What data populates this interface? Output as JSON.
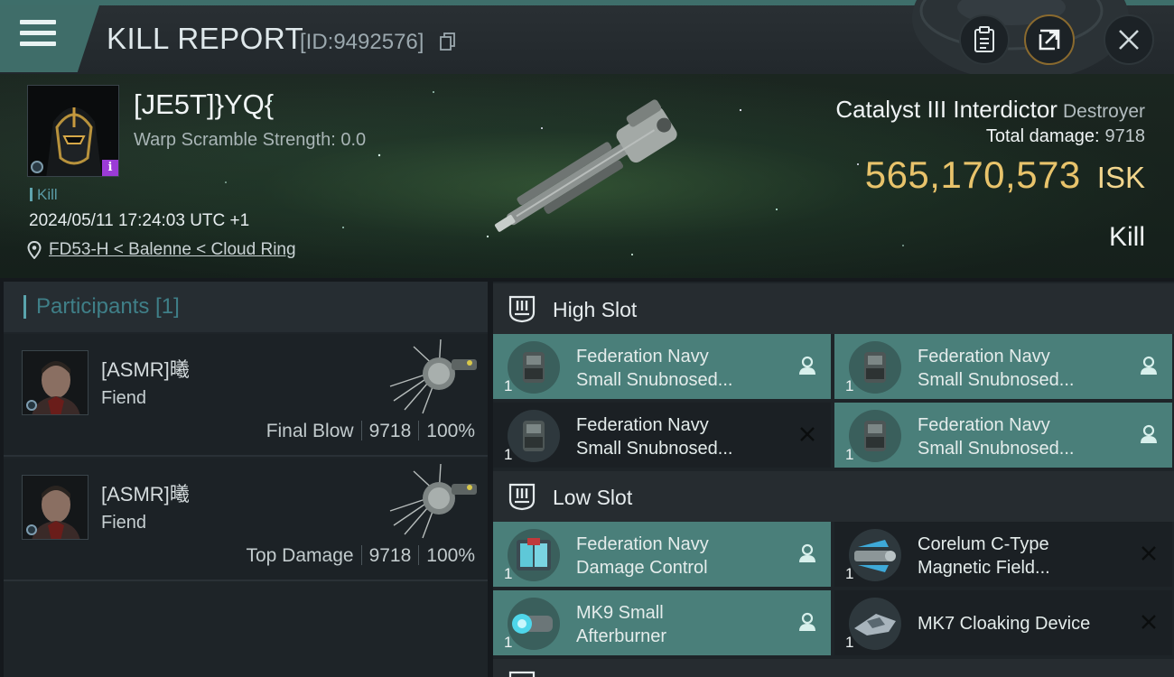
{
  "header": {
    "title": "KILL REPORT",
    "report_id": "[ID:9492576]"
  },
  "victim": {
    "name": "[JE5T]}YQ{",
    "warp_scramble": "Warp Scramble Strength: 0.0",
    "kill_tag": "Kill",
    "timestamp": "2024/05/11 17:24:03 UTC +1",
    "location": "FD53-H < Balenne < Cloud Ring"
  },
  "ship": {
    "name": "Catalyst III Interdictor",
    "class": "Destroyer",
    "total_damage_label": "Total damage:",
    "total_damage": "9718",
    "isk_value": "565,170,573",
    "isk_unit": "ISK",
    "result": "Kill"
  },
  "participants": {
    "title": "Participants [1]",
    "items": [
      {
        "name": "[ASMR]曦",
        "ship": "Fiend",
        "role": "Final Blow",
        "damage": "9718",
        "percent": "100%"
      },
      {
        "name": "[ASMR]曦",
        "ship": "Fiend",
        "role": "Top Damage",
        "damage": "9718",
        "percent": "100%"
      }
    ]
  },
  "slots": {
    "high_title": "High Slot",
    "low_title": "Low Slot",
    "high": [
      {
        "name": "Federation Navy Small Snubnosed...",
        "line1": "Federation Navy",
        "line2": "Small Snubnosed...",
        "qty": "1",
        "status": "dropped"
      },
      {
        "name": "Federation Navy Small Snubnosed...",
        "line1": "Federation Navy",
        "line2": "Small Snubnosed...",
        "qty": "1",
        "status": "dropped"
      },
      {
        "name": "Federation Navy Small Snubnosed...",
        "line1": "Federation Navy",
        "line2": "Small Snubnosed...",
        "qty": "1",
        "status": "destroyed"
      },
      {
        "name": "Federation Navy Small Snubnosed...",
        "line1": "Federation Navy",
        "line2": "Small Snubnosed...",
        "qty": "1",
        "status": "dropped"
      }
    ],
    "low": [
      {
        "line1": "Federation Navy",
        "line2": "Damage Control",
        "qty": "1",
        "status": "dropped"
      },
      {
        "line1": "Corelum C-Type",
        "line2": "Magnetic Field...",
        "qty": "1",
        "status": "destroyed"
      },
      {
        "line1": "MK9 Small",
        "line2": "Afterburner",
        "qty": "1",
        "status": "dropped"
      },
      {
        "line1": "MK7 Cloaking Device",
        "line2": "",
        "qty": "1",
        "status": "destroyed"
      }
    ]
  },
  "colors": {
    "accent_teal": "#4a7f7a",
    "isk_gold": "#e8c36b",
    "info_badge": "#9b3bd6"
  }
}
